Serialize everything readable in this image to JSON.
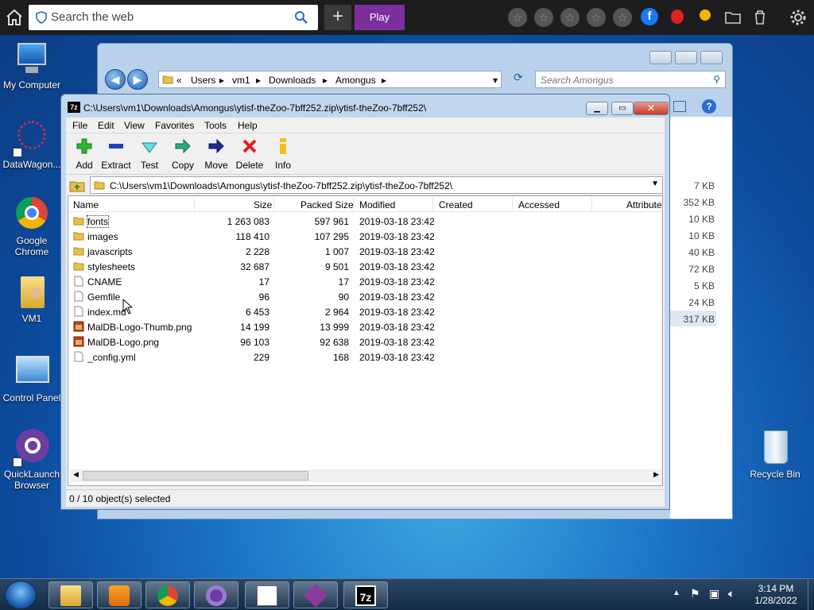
{
  "topbar": {
    "search_placeholder": "Search the web",
    "play_label": "Play",
    "plus_label": "+"
  },
  "desktop": {
    "icons": [
      {
        "label": "My Computer"
      },
      {
        "label": "DataWagon..."
      },
      {
        "label": "Google Chrome"
      },
      {
        "label": "VM1"
      },
      {
        "label": "Control Panel"
      },
      {
        "label": "QuickLaunch Browser"
      },
      {
        "label": "Recycle Bin"
      }
    ]
  },
  "explorer": {
    "breadcrumb_prefix": "«",
    "path": [
      "Users",
      "vm1",
      "Downloads",
      "Amongus"
    ],
    "search_placeholder": "Search Amongus",
    "sizes": [
      "7 KB",
      "352 KB",
      "10 KB",
      "10 KB",
      "40 KB",
      "72 KB",
      "5 KB",
      "24 KB",
      "317 KB"
    ]
  },
  "zip": {
    "title": "C:\\Users\\vm1\\Downloads\\Amongus\\ytisf-theZoo-7bff252.zip\\ytisf-theZoo-7bff252\\",
    "logo": "7z",
    "menu": [
      "File",
      "Edit",
      "View",
      "Favorites",
      "Tools",
      "Help"
    ],
    "tools": [
      "Add",
      "Extract",
      "Test",
      "Copy",
      "Move",
      "Delete",
      "Info"
    ],
    "path": "C:\\Users\\vm1\\Downloads\\Amongus\\ytisf-theZoo-7bff252.zip\\ytisf-theZoo-7bff252\\",
    "columns": [
      "Name",
      "Size",
      "Packed Size",
      "Modified",
      "Created",
      "Accessed",
      "Attributes"
    ],
    "rows": [
      {
        "name": "fonts",
        "size": "1 263 083",
        "packed": "597 961",
        "modified": "2019-03-18 23:42",
        "type": "folder"
      },
      {
        "name": "images",
        "size": "118 410",
        "packed": "107 295",
        "modified": "2019-03-18 23:42",
        "type": "folder"
      },
      {
        "name": "javascripts",
        "size": "2 228",
        "packed": "1 007",
        "modified": "2019-03-18 23:42",
        "type": "folder"
      },
      {
        "name": "stylesheets",
        "size": "32 687",
        "packed": "9 501",
        "modified": "2019-03-18 23:42",
        "type": "folder"
      },
      {
        "name": "CNAME",
        "size": "17",
        "packed": "17",
        "modified": "2019-03-18 23:42",
        "type": "file"
      },
      {
        "name": "Gemfile",
        "size": "96",
        "packed": "90",
        "modified": "2019-03-18 23:42",
        "type": "file"
      },
      {
        "name": "index.md",
        "size": "6 453",
        "packed": "2 964",
        "modified": "2019-03-18 23:42",
        "type": "file"
      },
      {
        "name": "MalDB-Logo-Thumb.png",
        "size": "14 199",
        "packed": "13 999",
        "modified": "2019-03-18 23:42",
        "type": "image"
      },
      {
        "name": "MalDB-Logo.png",
        "size": "96 103",
        "packed": "92 638",
        "modified": "2019-03-18 23:42",
        "type": "image"
      },
      {
        "name": "_config.yml",
        "size": "229",
        "packed": "168",
        "modified": "2019-03-18 23:42",
        "type": "file"
      }
    ],
    "status": "0 / 10 object(s) selected"
  },
  "taskbar": {
    "time": "3:14 PM",
    "date": "1/28/2022"
  },
  "colors": {
    "play_purple": "#7b2f9e",
    "taskbar": "#1e3652",
    "close_red": "#c43b25"
  }
}
